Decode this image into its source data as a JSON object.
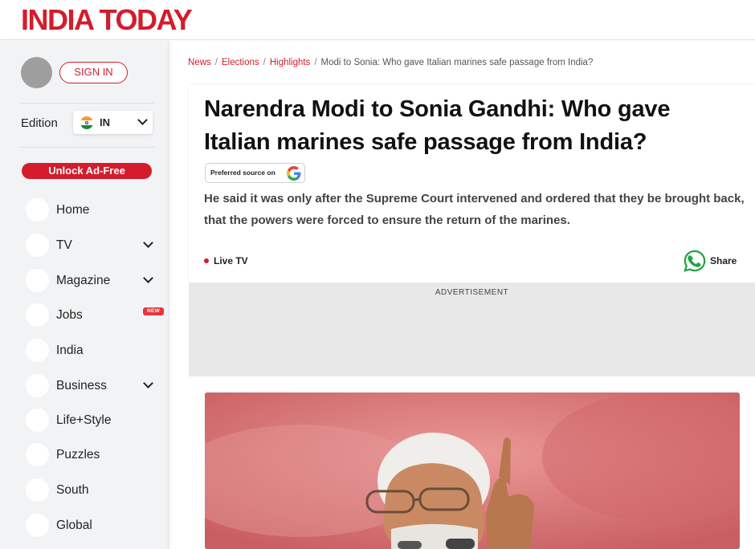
{
  "header": {
    "logo": "INDIA TODAY"
  },
  "sidebar": {
    "sign_in": "SIGN IN",
    "edition_label": "Edition",
    "edition_value": "IN",
    "unlock": "Unlock Ad-Free",
    "items": [
      {
        "label": "Home"
      },
      {
        "label": "TV"
      },
      {
        "label": "Magazine"
      },
      {
        "label": "Jobs",
        "badge": "NEW"
      },
      {
        "label": "India"
      },
      {
        "label": "Business"
      },
      {
        "label": "Life+Style"
      },
      {
        "label": "Puzzles"
      },
      {
        "label": "South"
      },
      {
        "label": "Global"
      }
    ]
  },
  "breadcrumb": {
    "items": [
      "News",
      "Elections",
      "Highlights"
    ],
    "current": "Modi to Sonia: Who gave Italian marines safe passage from India?"
  },
  "article": {
    "headline": "Narendra Modi to Sonia Gandhi: Who gave Italian marines safe passage from India?",
    "preferred_source": "Preferred source on",
    "summary": "He said it was only after the Supreme Court intervened and ordered that they be brought back, that the powers were forced to ensure the return of the marines.",
    "live_tv": "Live TV",
    "share": "Share",
    "advertisement": "ADVERTISEMENT"
  },
  "colors": {
    "brand": "#d41c2c",
    "whatsapp": "#25a244"
  },
  "icons": [
    "india-flag-icon",
    "chevron-down-icon",
    "google-logo-icon",
    "whatsapp-icon",
    "live-dot-icon"
  ]
}
